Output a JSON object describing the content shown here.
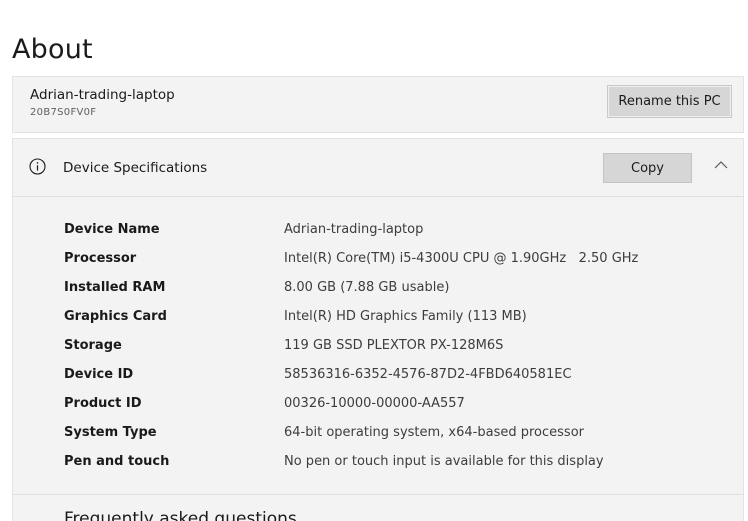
{
  "page": {
    "title": "About"
  },
  "pc": {
    "name": "Adrian-trading-laptop",
    "model": "20B7S0FV0F",
    "rename_label": "Rename this PC"
  },
  "device_specs": {
    "title": "Device Specifications",
    "copy_label": "Copy",
    "icon": "info-icon",
    "collapse_icon": "chevron-up-icon",
    "rows": [
      {
        "label": "Device Name",
        "value": "Adrian-trading-laptop"
      },
      {
        "label": "Processor",
        "value": "Intel(R) Core(TM) i5-4300U CPU @ 1.90GHz   2.50 GHz"
      },
      {
        "label": "Installed RAM",
        "value": "8.00 GB (7.88 GB usable)"
      },
      {
        "label": "Graphics Card",
        "value": "Intel(R) HD Graphics Family (113 MB)"
      },
      {
        "label": "Storage",
        "value": "119 GB SSD PLEXTOR PX-128M6S"
      },
      {
        "label": "Device ID",
        "value": "58536316-6352-4576-87D2-4FBD640581EC"
      },
      {
        "label": "Product ID",
        "value": "00326-10000-00000-AA557"
      },
      {
        "label": "System Type",
        "value": "64-bit operating system, x64-based processor"
      },
      {
        "label": "Pen and touch",
        "value": "No pen or touch input is available for this display"
      }
    ]
  },
  "faq": {
    "title": "Frequently asked questions"
  }
}
